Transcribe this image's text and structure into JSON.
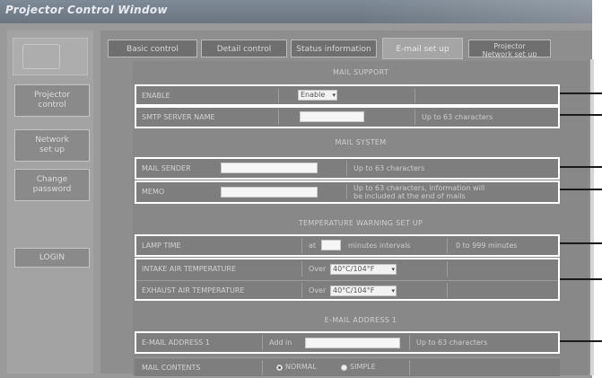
{
  "window": {
    "title": "Projector Control Window"
  },
  "sidebar": {
    "logo_icon": "projector-logo-icon",
    "items": [
      {
        "label": "Projector\ncontrol"
      },
      {
        "label": "Network\nset up"
      },
      {
        "label": "Change\npassword"
      },
      {
        "label": "LOGIN"
      }
    ]
  },
  "tabs": [
    {
      "label": "Basic control"
    },
    {
      "label": "Detail control"
    },
    {
      "label": "Status information"
    },
    {
      "label": "E-mail set up"
    },
    {
      "label": "Projector\nNetwork set up"
    }
  ],
  "sections": {
    "mail_supports": "MAIL SUPPORT",
    "mail_system": "MAIL SYSTEM",
    "temp_settings": "TEMPERATURE WARNING SET UP",
    "email_address": "E-MAIL ADDRESS 1"
  },
  "rows": {
    "enable": {
      "label": "ENABLE",
      "value": "Enable"
    },
    "sender_name": {
      "label": "SMTP SERVER NAME",
      "value": "",
      "note": "Up to 63 characters"
    },
    "mail_sender": {
      "label": "MAIL SENDER",
      "value": "",
      "note": "Up to 63 characters"
    },
    "memo": {
      "label": "MEMO",
      "value": "",
      "note": "Up to 63 characters, information will\nbe included at the end of mails"
    },
    "lamp_time": {
      "label": "LAMP TIME",
      "prefix": "at",
      "value": "",
      "mid": "minutes intervals",
      "note": "0 to 999 minutes"
    },
    "intake_temp": {
      "label": "INTAKE AIR TEMPERATURE",
      "prefix": "Over",
      "value": "40°C/104°F"
    },
    "exhaust_temp": {
      "label": "EXHAUST AIR TEMPERATURE",
      "prefix": "Over",
      "value": "40°C/104°F"
    },
    "email_address1": {
      "label": "E-MAIL ADDRESS 1",
      "prefix": "Add in",
      "value": "",
      "note": "Up to 63 characters"
    },
    "mail_contents": {
      "label": "MAIL CONTENTS",
      "options": [
        "NORMAL",
        "SIMPLE"
      ],
      "selected": "NORMAL"
    }
  },
  "colors": {
    "highlight": "#ffffff",
    "leader": "#1a1a1a"
  }
}
